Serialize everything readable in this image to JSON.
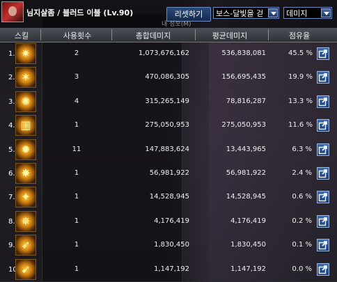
{
  "window": {
    "title": "님지살좀 / 블러드 이블 (Lv.90)",
    "reset_label": "리셋하기",
    "target_select": "보스-달빛을 걷",
    "mode_select": "데미지",
    "subtitle": "내 정보(M)"
  },
  "columns": {
    "skill": "스킬",
    "uses": "사용횟수",
    "total": "총합데미지",
    "avg": "평균데미지",
    "share": "점유율"
  },
  "rows": [
    {
      "rank": "1.",
      "uses": "2",
      "total": "1,073,676,162",
      "avg": "536,838,081",
      "share": "45.5 %",
      "icon": "skill-icon-1"
    },
    {
      "rank": "2.",
      "uses": "3",
      "total": "470,086,305",
      "avg": "156,695,435",
      "share": "19.9 %",
      "icon": "skill-icon-2"
    },
    {
      "rank": "3.",
      "uses": "4",
      "total": "315,265,149",
      "avg": "78,816,287",
      "share": "13.3 %",
      "icon": "skill-icon-3"
    },
    {
      "rank": "4.",
      "uses": "1",
      "total": "275,050,953",
      "avg": "275,050,953",
      "share": "11.6 %",
      "icon": "skill-icon-4"
    },
    {
      "rank": "5.",
      "uses": "11",
      "total": "147,883,624",
      "avg": "13,443,965",
      "share": "6.3 %",
      "icon": "skill-icon-5"
    },
    {
      "rank": "6.",
      "uses": "1",
      "total": "56,981,922",
      "avg": "56,981,922",
      "share": "2.4 %",
      "icon": "skill-icon-6"
    },
    {
      "rank": "7.",
      "uses": "1",
      "total": "14,528,945",
      "avg": "14,528,945",
      "share": "0.6 %",
      "icon": "skill-icon-7"
    },
    {
      "rank": "8.",
      "uses": "1",
      "total": "4,176,419",
      "avg": "4,176,419",
      "share": "0.2 %",
      "icon": "skill-icon-8"
    },
    {
      "rank": "9.",
      "uses": "1",
      "total": "1,830,450",
      "avg": "1,830,450",
      "share": "0.1 %",
      "icon": "skill-icon-9"
    },
    {
      "rank": "10.",
      "uses": "1",
      "total": "1,147,192",
      "avg": "1,147,192",
      "share": "0.0 %",
      "icon": "skill-icon-10"
    }
  ],
  "colors": {
    "header_bg": "#3a3e46",
    "button_blue": "#1f3866",
    "icon_gold": "#d08010"
  }
}
